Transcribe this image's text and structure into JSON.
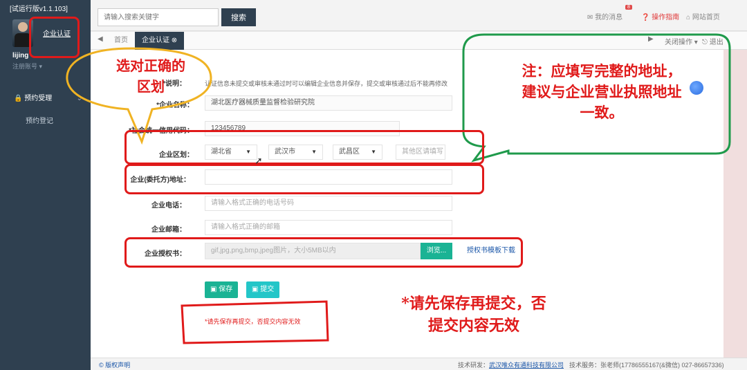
{
  "sidebar": {
    "version": "[试运行版v1.1.103]",
    "cert_link": "企业认证",
    "username": "lijing",
    "register": "注册账号 ▾",
    "nav_group": "预约受理",
    "nav_sub": "预约登记"
  },
  "topbar": {
    "search_placeholder": "请输入搜索关键字",
    "search_label": "搜索",
    "messages": "我的消息",
    "badge": "8",
    "guide": "操作指南",
    "home": "网站首页"
  },
  "tabs": {
    "home": "首页",
    "active": "企业认证",
    "close_ops": "关闭操作",
    "logout": "退出"
  },
  "form": {
    "note_label": "*说明：",
    "note_text": "认证信息未提交或审核未通过时可以编辑企业信息并保存，提交或审核通过后不能再修改",
    "name_label": "*企业名称：",
    "name_value": "湖北医疗器械质量监督检验研究院",
    "code_label": "*社会统一信用代码：",
    "code_value": "123456789",
    "region_label": "企业区划：",
    "province": "湖北省",
    "city": "武汉市",
    "district": "武昌区",
    "other_region_placeholder": "其他区请填写",
    "address_label": "企业(委托方)地址：",
    "phone_label": "企业电话：",
    "phone_placeholder": "请输入格式正确的电话号码",
    "email_label": "企业邮箱：",
    "email_placeholder": "请输入格式正确的邮箱",
    "auth_label": "企业授权书：",
    "auth_placeholder": "gif,jpg,png,bmp,jpeg图片，大小5MB以内",
    "browse": "浏览...",
    "template_link": "授权书模板下载",
    "save": "保存",
    "submit": "提交",
    "warning_small": "*请先保存再提交，否提交内容无效"
  },
  "annotations": {
    "yellow_bubble": [
      "选对正确的",
      "区划"
    ],
    "green_bubble": [
      "注：应填写完整的地址，",
      "建议与企业营业执照地址",
      "一致。"
    ],
    "red_note": [
      "*请先保存再提交，否",
      "提交内容无效"
    ]
  },
  "footer": {
    "copyright": "版权声明",
    "tech_label": "技术研发：",
    "tech_company": "武汉唯众有通科技有限公司",
    "service": "技术服务：张老师(17786555167(&微信) 027-86657336)"
  },
  "colors": {
    "sidebar_bg": "#2f4050",
    "accent_green": "#1ab394",
    "annotation_red": "#e01a1a",
    "annotation_yellow": "#f0b323",
    "annotation_green": "#1f9a4b"
  }
}
